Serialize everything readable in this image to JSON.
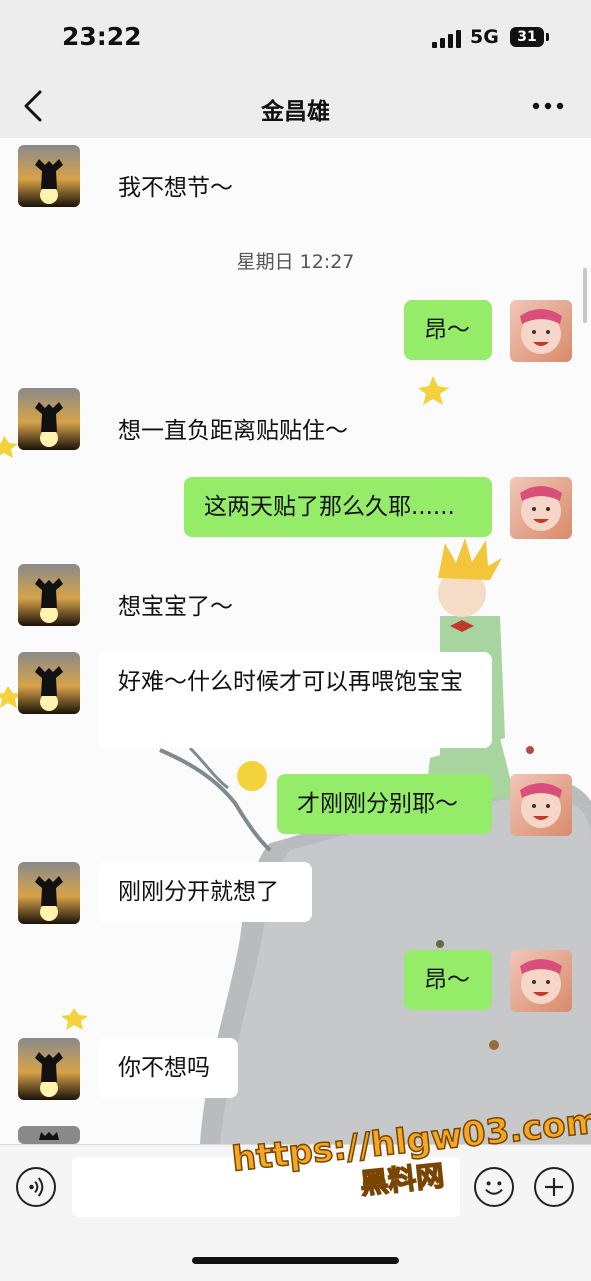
{
  "status_bar": {
    "time": "23:22",
    "network": "5G",
    "battery": "31"
  },
  "header": {
    "title": "金昌雄"
  },
  "conversation": {
    "timestamp": "星期日 12:27",
    "messages": [
      {
        "side": "in",
        "text": "我不想节～"
      },
      {
        "side": "out",
        "text": "昂～"
      },
      {
        "side": "in",
        "text": "想一直负距离贴贴住～"
      },
      {
        "side": "out",
        "text": "这两天贴了那么久耶......"
      },
      {
        "side": "in",
        "text": "想宝宝了～"
      },
      {
        "side": "in",
        "text": "好难～什么时候才可以再喂饱宝宝"
      },
      {
        "side": "out",
        "text": "才刚刚分别耶～"
      },
      {
        "side": "in",
        "text": "刚刚分开就想了"
      },
      {
        "side": "out",
        "text": "昂～"
      },
      {
        "side": "in",
        "text": "你不想吗"
      }
    ]
  },
  "watermark": {
    "line1": "https://hlgw03.com",
    "line2": "黑料网"
  },
  "colors": {
    "outgoing_bubble": "#95ec69",
    "incoming_bubble": "#ffffff",
    "background": "#ededed"
  },
  "icons": [
    "back-arrow-icon",
    "more-icon",
    "voice-icon",
    "emoji-icon",
    "plus-icon"
  ]
}
